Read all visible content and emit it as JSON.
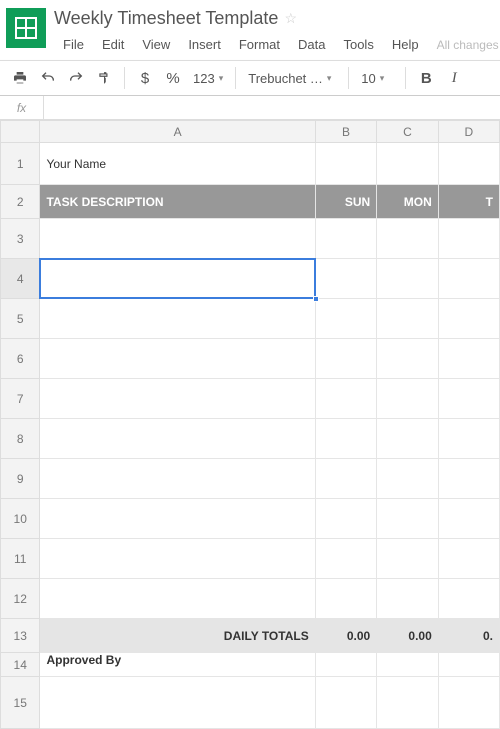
{
  "doc": {
    "title": "Weekly Timesheet Template",
    "saved": "All changes s"
  },
  "menu": {
    "file": "File",
    "edit": "Edit",
    "view": "View",
    "insert": "Insert",
    "format": "Format",
    "data": "Data",
    "tools": "Tools",
    "help": "Help"
  },
  "toolbar": {
    "currency": "$",
    "percent": "%",
    "numfmt": "123",
    "font": "Trebuchet …",
    "size": "10",
    "bold": "B",
    "italic": "I"
  },
  "fx": {
    "label": "fx"
  },
  "cols": {
    "A": "A",
    "B": "B",
    "C": "C",
    "D": "D"
  },
  "rows": [
    "1",
    "2",
    "3",
    "4",
    "5",
    "6",
    "7",
    "8",
    "9",
    "10",
    "11",
    "12",
    "13",
    "14",
    "15"
  ],
  "sheet": {
    "name": "Your Name",
    "task_header": "TASK DESCRIPTION",
    "days": {
      "sun": "SUN",
      "mon": "MON",
      "tue": "T"
    },
    "totals_label": "DAILY TOTALS",
    "totals": {
      "b": "0.00",
      "c": "0.00",
      "d": "0."
    },
    "approved": "Approved By"
  }
}
